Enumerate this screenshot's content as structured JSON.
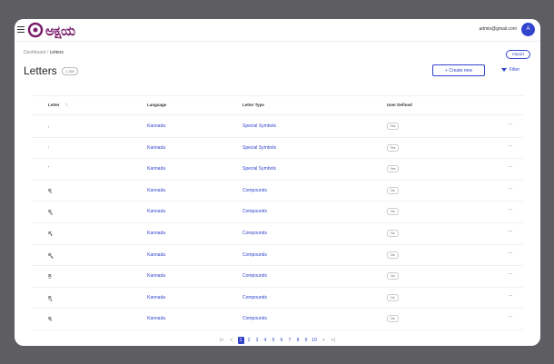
{
  "app": {
    "logo_text": "ಅಕ್ಷಯ",
    "user_email": "admin@gmail.com",
    "user_initial": "A"
  },
  "breadcrumb": {
    "parent": "Dashboard",
    "separator": "/",
    "current": "Letters"
  },
  "header": {
    "title": "Letters",
    "count": "1,350",
    "import_label": "Import",
    "create_label": "+ Create new",
    "filter_label": "Filter"
  },
  "table": {
    "columns": [
      "Letter",
      "Language",
      "Letter Type",
      "User Defined"
    ],
    "rows": [
      {
        "letter": ",",
        "language": "Kannada",
        "type": "Special Symbols",
        "user_defined": "Yes"
      },
      {
        "letter": ":",
        "language": "Kannada",
        "type": "Special Symbols",
        "user_defined": "Yes"
      },
      {
        "letter": "'",
        "language": "Kannada",
        "type": "Special Symbols",
        "user_defined": "Yes"
      },
      {
        "letter": "ಹ್ಜ",
        "language": "Kannada",
        "type": "Compounds",
        "user_defined": "No"
      },
      {
        "letter": "ಹ್ಜ್ಯ",
        "language": "Kannada",
        "type": "Compounds",
        "user_defined": "No"
      },
      {
        "letter": "ಹ್ಮ",
        "language": "Kannada",
        "type": "Compounds",
        "user_defined": "No"
      },
      {
        "letter": "ಹ್ಮ್ಯ",
        "language": "Kannada",
        "type": "Compounds",
        "user_defined": "No"
      },
      {
        "letter": "ಹ್ರ",
        "language": "Kannada",
        "type": "Compounds",
        "user_defined": "No"
      },
      {
        "letter": "ಹ್ರ್ಯ",
        "language": "Kannada",
        "type": "Compounds",
        "user_defined": "No"
      },
      {
        "letter": "ಹ್ಲ",
        "language": "Kannada",
        "type": "Compounds",
        "user_defined": "No"
      }
    ]
  },
  "pagination": {
    "first": "|<",
    "prev": "<",
    "pages": [
      "1",
      "2",
      "3",
      "4",
      "5",
      "6",
      "7",
      "8",
      "9",
      "10"
    ],
    "active_page": "1",
    "next": ">",
    "last": ">|"
  },
  "colors": {
    "accent": "#3344cc",
    "brand": "#7a1d6a",
    "frame": "#5e5e62"
  }
}
